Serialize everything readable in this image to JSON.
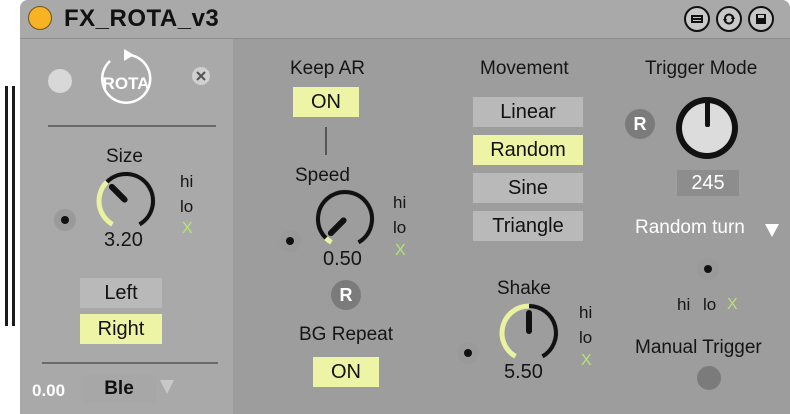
{
  "device": {
    "title": "FX_ROTA_v3",
    "logo_text": "ROTA",
    "colors": {
      "accent": "#eef4a6",
      "title_dot": "#f7b324",
      "knob_arc": "#e9f2a2"
    }
  },
  "left": {
    "size_label": "Size",
    "size_value": "3.20",
    "size_fraction": 0.35,
    "hi": "hi",
    "lo": "lo",
    "x": "X",
    "direction": [
      "Left",
      "Right"
    ],
    "direction_selected": "Right",
    "bottom_value": "0.00",
    "bottom_select": "Ble"
  },
  "keep_ar": {
    "label": "Keep AR",
    "value": "ON"
  },
  "speed": {
    "label": "Speed",
    "value": "0.50",
    "fraction": 0.05,
    "hi": "hi",
    "lo": "lo",
    "x": "X",
    "r": "R"
  },
  "bg_repeat": {
    "label": "BG Repeat",
    "value": "ON"
  },
  "movement": {
    "label": "Movement",
    "options": [
      "Linear",
      "Random",
      "Sine",
      "Triangle"
    ],
    "selected": "Random"
  },
  "shake": {
    "label": "Shake",
    "value": "5.50",
    "fraction": 0.5,
    "hi": "hi",
    "lo": "lo",
    "x": "X"
  },
  "trigger": {
    "label": "Trigger Mode",
    "r": "R",
    "value": "245",
    "mode": "Random turn",
    "hi": "hi",
    "lo": "lo",
    "x": "X",
    "manual_label": "Manual Trigger"
  }
}
